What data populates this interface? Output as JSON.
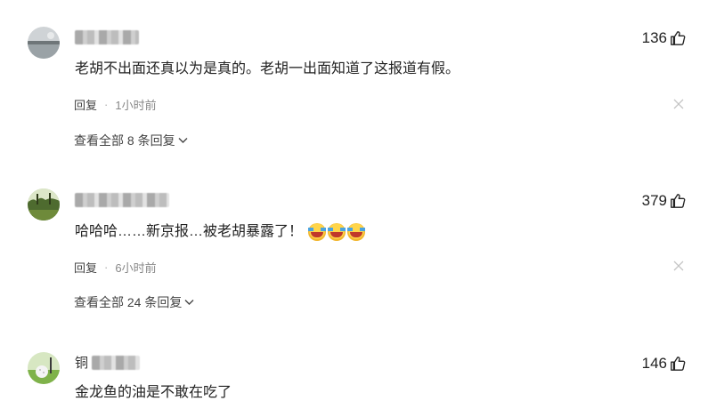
{
  "comments": [
    {
      "username": "",
      "likes": "136",
      "text": "老胡不出面还真以为是真的。老胡一出面知道了这报道有假。",
      "reply_label": "回复",
      "dot": "·",
      "time": "1小时前",
      "view_all": "查看全部 8 条回复"
    },
    {
      "username": "",
      "likes": "379",
      "text": "哈哈哈……新京报…被老胡暴露了！",
      "reply_label": "回复",
      "dot": "·",
      "time": "6小时前",
      "view_all": "查看全部 24 条回复"
    },
    {
      "username": "铜",
      "likes": "146",
      "text": "金龙鱼的油是不敢在吃了"
    }
  ],
  "icons": {
    "like": "thumbs-up-icon",
    "close": "close-icon",
    "chevron": "chevron-down-icon",
    "emoji": "laughing-tears-emoji"
  }
}
